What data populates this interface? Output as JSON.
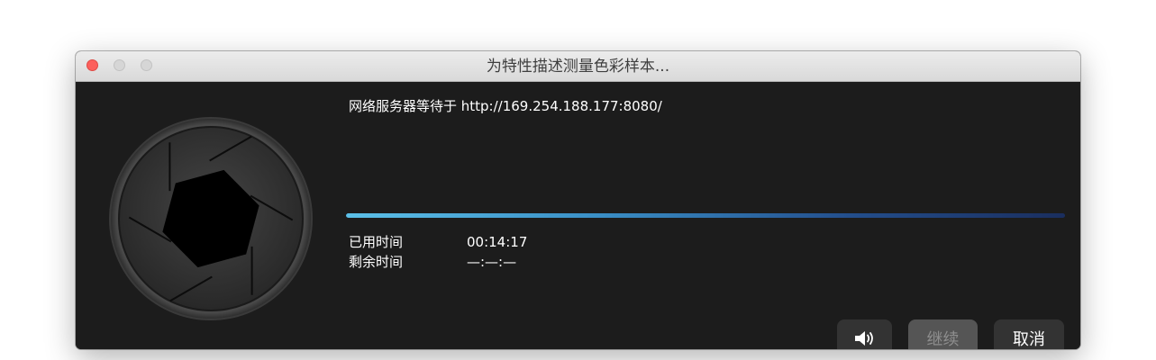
{
  "window": {
    "title": "为特性描述测量色彩样本..."
  },
  "status": {
    "message": "网络服务器等待于 http://169.254.188.177:8080/"
  },
  "progress": {
    "fraction": 1.0
  },
  "timing": {
    "elapsed_label": "已用时间",
    "elapsed_value": "00:14:17",
    "remaining_label": "剩余时间",
    "remaining_value": "—:—:—"
  },
  "buttons": {
    "sound_icon": "speaker-volume-icon",
    "continue_label": "继续",
    "continue_enabled": false,
    "cancel_label": "取消"
  },
  "colors": {
    "background": "#1c1c1c",
    "progress_start": "#5cc0e8",
    "progress_end": "#1a2e5e",
    "close_button": "#fc605c"
  }
}
